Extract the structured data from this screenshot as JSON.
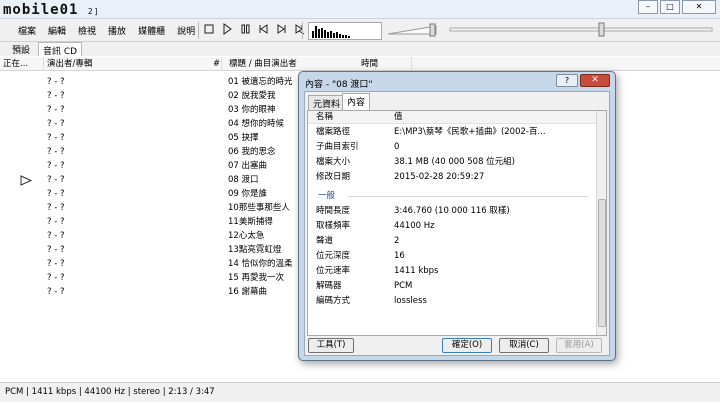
{
  "window": {
    "logo_text": "mobile01",
    "title_suffix": "2]",
    "controls": [
      "–",
      "□",
      "✕"
    ]
  },
  "menu": [
    "檔案",
    "編輯",
    "檢視",
    "播放",
    "媒體櫃",
    "說明"
  ],
  "transport_icons": [
    "stop-icon",
    "play-icon",
    "pause-icon",
    "previous-icon",
    "next-icon",
    "random-icon"
  ],
  "tabs": [
    "預設",
    "音訊 CD"
  ],
  "columns": [
    "正在...",
    "演出者/專輯",
    "#",
    "標題 / 曲目演出者",
    "時間"
  ],
  "tracks": [
    {
      "artist": "? - ?",
      "title": "01 被遺忘的時光"
    },
    {
      "artist": "? - ?",
      "title": "02 說我愛我"
    },
    {
      "artist": "? - ?",
      "title": "03 你的眼神"
    },
    {
      "artist": "? - ?",
      "title": "04 想你的時候"
    },
    {
      "artist": "? - ?",
      "title": "05 抉擇"
    },
    {
      "artist": "? - ?",
      "title": "06 我的思念"
    },
    {
      "artist": "? - ?",
      "title": "07 出塞曲"
    },
    {
      "artist": "? - ?",
      "title": "08 渡口",
      "playing": true
    },
    {
      "artist": "? - ?",
      "title": "09 你是誰"
    },
    {
      "artist": "? - ?",
      "title": "10那些事那些人"
    },
    {
      "artist": "? - ?",
      "title": "11美斯捕得"
    },
    {
      "artist": "? - ?",
      "title": "12心太急"
    },
    {
      "artist": "? - ?",
      "title": "13點亮霓虹燈"
    },
    {
      "artist": "? - ?",
      "title": "14 恰似你的溫柔"
    },
    {
      "artist": "? - ?",
      "title": "15 再愛我一次"
    },
    {
      "artist": "? - ?",
      "title": "16 謝幕曲"
    }
  ],
  "status": {
    "text": "PCM | 1411 kbps | 44100 Hz | stereo | 2:13 / 3:47"
  },
  "dialog": {
    "title": "內容 - \"08 渡口\"",
    "help": "?",
    "close": "✕",
    "tabs": [
      "元資料",
      "內容"
    ],
    "header": {
      "name": "名稱",
      "value": "值"
    },
    "rows": [
      {
        "k": "檔案路徑",
        "v": "E:\\MP3\\蔡琴《民歌+插曲》(2002-百..."
      },
      {
        "k": "子曲目索引",
        "v": "0"
      },
      {
        "k": "檔案大小",
        "v": "38.1 MB (40 000 508 位元組)"
      },
      {
        "k": "修改日期",
        "v": "2015-02-28 20:59:27"
      }
    ],
    "section": "一般",
    "general": [
      {
        "k": "時間長度",
        "v": "3:46.760 (10 000 116 取樣)"
      },
      {
        "k": "取樣頻率",
        "v": "44100 Hz"
      },
      {
        "k": "聲道",
        "v": "2"
      },
      {
        "k": "位元深度",
        "v": "16"
      },
      {
        "k": "位元速率",
        "v": "1411 kbps"
      },
      {
        "k": "解碼器",
        "v": "PCM"
      },
      {
        "k": "編碼方式",
        "v": "lossless"
      }
    ],
    "buttons": {
      "tools": "工具(T)",
      "ok": "確定(O)",
      "cancel": "取消(C)",
      "apply": "套用(A)"
    }
  }
}
